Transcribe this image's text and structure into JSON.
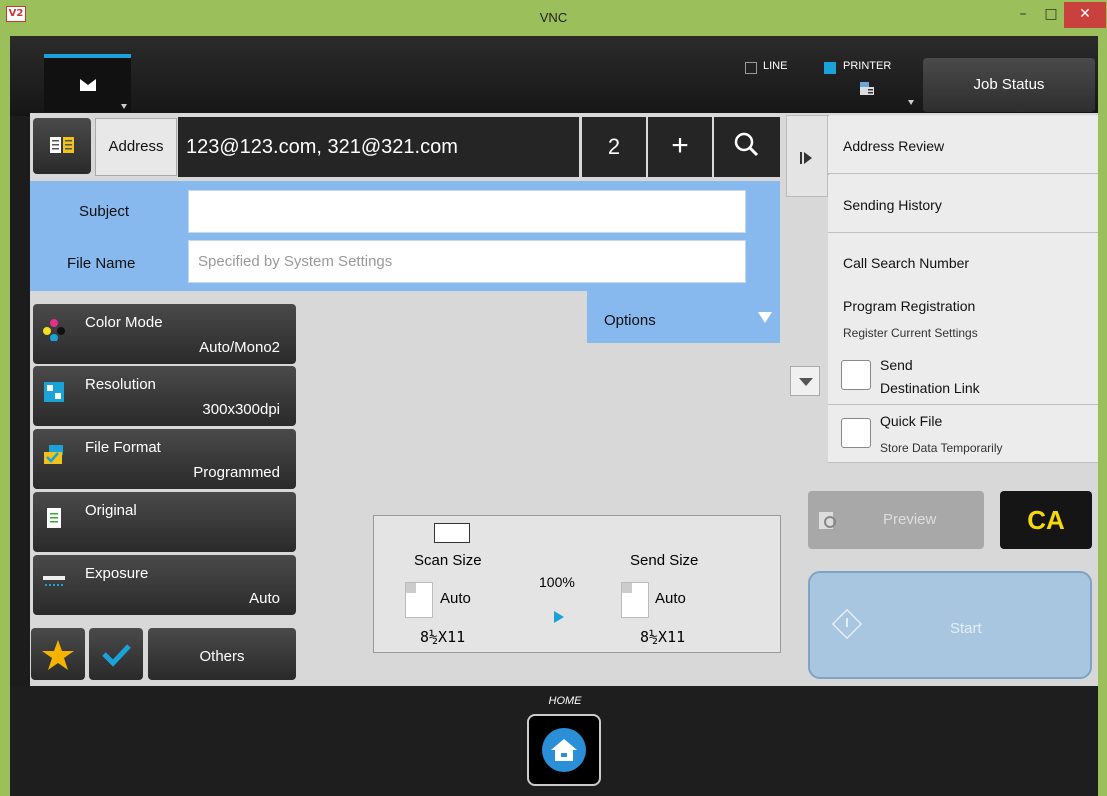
{
  "window": {
    "title": "VNC",
    "minimize": "–",
    "maximize": "□",
    "close": "✕"
  },
  "topbar": {
    "line_label": "LINE",
    "printer_label": "PRINTER",
    "job_status_label": "Job Status",
    "accent": "#1aa3d9"
  },
  "address": {
    "label": "Address",
    "value": "123@123.com, 321@321.com",
    "count": "2",
    "plus": "+"
  },
  "fields": {
    "subject_label": "Subject",
    "subject_value": "",
    "filename_label": "File Name",
    "filename_placeholder": "Specified by System Settings",
    "options_label": "Options"
  },
  "function_buttons": [
    {
      "title": "Color Mode",
      "value": "Auto/Mono2",
      "icon": "color-mode-icon"
    },
    {
      "title": "Resolution",
      "value": "300x300dpi",
      "icon": "resolution-icon"
    },
    {
      "title": "File Format",
      "value": "Programmed",
      "icon": "file-format-icon"
    },
    {
      "title": "Original",
      "value": "",
      "icon": "original-icon"
    },
    {
      "title": "Exposure",
      "value": "Auto",
      "icon": "exposure-icon"
    }
  ],
  "bottom_buttons": {
    "others_label": "Others"
  },
  "scan": {
    "scan_size_label": "Scan Size",
    "scan_size_value": "Auto",
    "scan_paper": "8½X11",
    "ratio": "100%",
    "send_size_label": "Send Size",
    "send_size_value": "Auto",
    "send_paper": "8½X11"
  },
  "right_panel": {
    "items": [
      {
        "label": "Address Review"
      },
      {
        "label": "Sending History"
      },
      {
        "label": "Call Search Number"
      },
      {
        "label": "Program Registration",
        "sub": "Register Current Settings"
      },
      {
        "label": "Send",
        "sub": "Destination Link"
      },
      {
        "label": "Quick File",
        "sub": "Store Data Temporarily"
      }
    ]
  },
  "actions": {
    "preview_label": "Preview",
    "ca_label": "CA",
    "start_label": "Start"
  },
  "home": {
    "label": "HOME"
  }
}
